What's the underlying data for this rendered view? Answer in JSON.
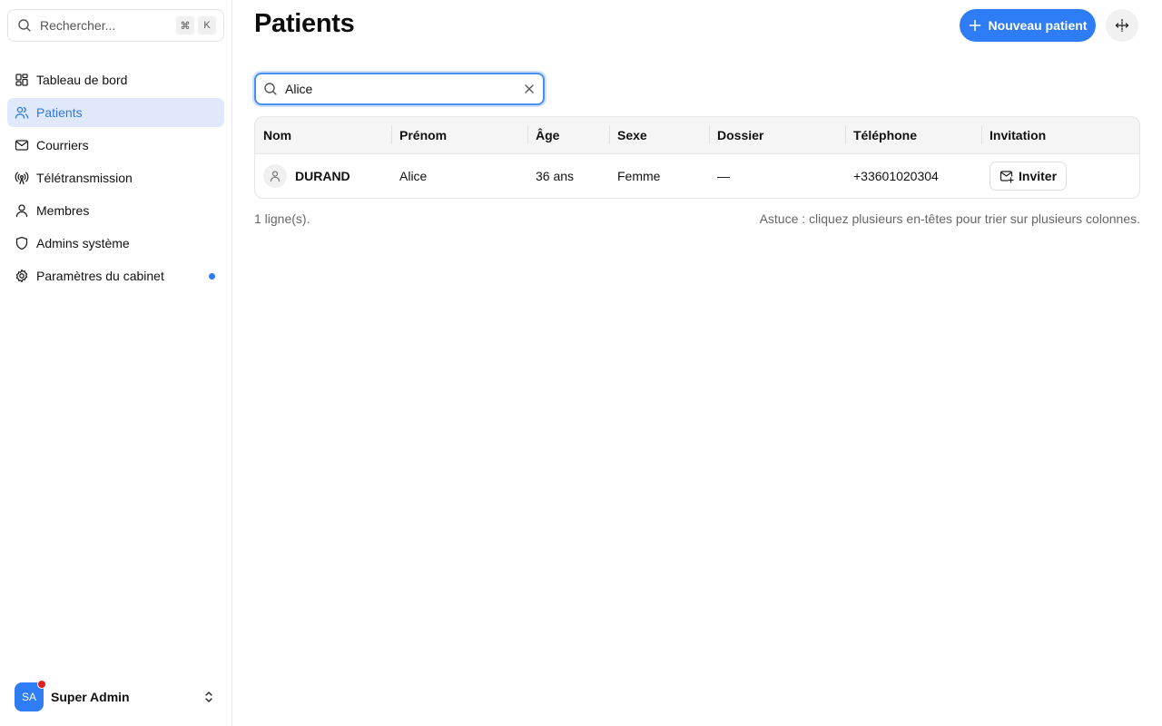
{
  "sidebar": {
    "search": {
      "placeholder": "Rechercher...",
      "shortcut_keys": [
        "⌘",
        "K"
      ]
    },
    "items": [
      {
        "label": "Tableau de bord",
        "icon": "dashboard-icon",
        "active": false
      },
      {
        "label": "Patients",
        "icon": "users-icon",
        "active": true
      },
      {
        "label": "Courriers",
        "icon": "mail-icon",
        "active": false
      },
      {
        "label": "Télétransmission",
        "icon": "broadcast-icon",
        "active": false
      },
      {
        "label": "Membres",
        "icon": "user-icon",
        "active": false
      },
      {
        "label": "Admins système",
        "icon": "shield-icon",
        "active": false
      },
      {
        "label": "Paramètres du cabinet",
        "icon": "gear-icon",
        "active": false,
        "has_notification_dot": true
      }
    ],
    "user": {
      "initials": "SA",
      "name": "Super Admin",
      "has_badge": true
    }
  },
  "header": {
    "title": "Patients",
    "new_button_label": "Nouveau patient",
    "secondary_icon": "move-icon"
  },
  "filter": {
    "value": "Alice"
  },
  "table": {
    "columns": [
      "Nom",
      "Prénom",
      "Âge",
      "Sexe",
      "Dossier",
      "Téléphone",
      "Invitation"
    ],
    "rows": [
      {
        "nom": "DURAND",
        "prenom": "Alice",
        "age": "36 ans",
        "sexe": "Femme",
        "dossier": "—",
        "telephone": "+33601020304",
        "invitation_label": "Inviter"
      }
    ]
  },
  "footer": {
    "row_count": "1 ligne(s).",
    "tip": "Astuce : cliquez plusieurs en-têtes pour trier sur plusieurs colonnes."
  },
  "colors": {
    "accent": "#2e7cf6",
    "active_bg": "#dfe9fb",
    "notification": "#e11d1d"
  }
}
